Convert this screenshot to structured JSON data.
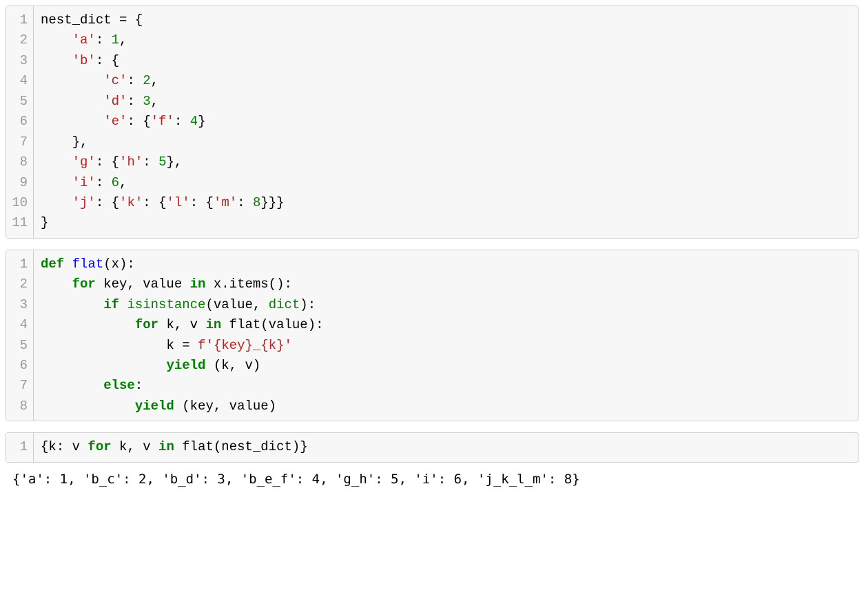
{
  "cells": [
    {
      "lines": [
        [
          {
            "t": "nest_dict "
          },
          {
            "t": "=",
            "cls": ""
          },
          {
            "t": " {"
          }
        ],
        [
          {
            "t": "    "
          },
          {
            "t": "'a'",
            "cls": "str"
          },
          {
            "t": ": "
          },
          {
            "t": "1",
            "cls": "num"
          },
          {
            "t": ","
          }
        ],
        [
          {
            "t": "    "
          },
          {
            "t": "'b'",
            "cls": "str"
          },
          {
            "t": ": {"
          }
        ],
        [
          {
            "t": "        "
          },
          {
            "t": "'c'",
            "cls": "str"
          },
          {
            "t": ": "
          },
          {
            "t": "2",
            "cls": "num"
          },
          {
            "t": ","
          }
        ],
        [
          {
            "t": "        "
          },
          {
            "t": "'d'",
            "cls": "str"
          },
          {
            "t": ": "
          },
          {
            "t": "3",
            "cls": "num"
          },
          {
            "t": ","
          }
        ],
        [
          {
            "t": "        "
          },
          {
            "t": "'e'",
            "cls": "str"
          },
          {
            "t": ": {"
          },
          {
            "t": "'f'",
            "cls": "str"
          },
          {
            "t": ": "
          },
          {
            "t": "4",
            "cls": "num"
          },
          {
            "t": "}"
          }
        ],
        [
          {
            "t": "    },"
          }
        ],
        [
          {
            "t": "    "
          },
          {
            "t": "'g'",
            "cls": "str"
          },
          {
            "t": ": {"
          },
          {
            "t": "'h'",
            "cls": "str"
          },
          {
            "t": ": "
          },
          {
            "t": "5",
            "cls": "num"
          },
          {
            "t": "},"
          }
        ],
        [
          {
            "t": "    "
          },
          {
            "t": "'i'",
            "cls": "str"
          },
          {
            "t": ": "
          },
          {
            "t": "6",
            "cls": "num"
          },
          {
            "t": ","
          }
        ],
        [
          {
            "t": "    "
          },
          {
            "t": "'j'",
            "cls": "str"
          },
          {
            "t": ": {"
          },
          {
            "t": "'k'",
            "cls": "str"
          },
          {
            "t": ": {"
          },
          {
            "t": "'l'",
            "cls": "str"
          },
          {
            "t": ": {"
          },
          {
            "t": "'m'",
            "cls": "str"
          },
          {
            "t": ": "
          },
          {
            "t": "8",
            "cls": "num"
          },
          {
            "t": "}}}"
          }
        ],
        [
          {
            "t": "}"
          }
        ]
      ]
    },
    {
      "lines": [
        [
          {
            "t": "def ",
            "cls": "kw"
          },
          {
            "t": "flat",
            "cls": "fn"
          },
          {
            "t": "(x):"
          }
        ],
        [
          {
            "t": "    "
          },
          {
            "t": "for ",
            "cls": "kw"
          },
          {
            "t": "key, value "
          },
          {
            "t": "in ",
            "cls": "kw"
          },
          {
            "t": "x"
          },
          {
            "t": "."
          },
          {
            "t": "items():"
          }
        ],
        [
          {
            "t": "        "
          },
          {
            "t": "if ",
            "cls": "kw"
          },
          {
            "t": "isinstance",
            "cls": "bi"
          },
          {
            "t": "(value, "
          },
          {
            "t": "dict",
            "cls": "bi"
          },
          {
            "t": "):"
          }
        ],
        [
          {
            "t": "            "
          },
          {
            "t": "for ",
            "cls": "kw"
          },
          {
            "t": "k, v "
          },
          {
            "t": "in ",
            "cls": "kw"
          },
          {
            "t": "flat(value):"
          }
        ],
        [
          {
            "t": "                k "
          },
          {
            "t": "="
          },
          {
            "t": " "
          },
          {
            "t": "f'",
            "cls": "sd"
          },
          {
            "t": "{key}",
            "cls": "str"
          },
          {
            "t": "_",
            "cls": "sd"
          },
          {
            "t": "{k}",
            "cls": "str"
          },
          {
            "t": "'",
            "cls": "sd"
          }
        ],
        [
          {
            "t": "                "
          },
          {
            "t": "yield ",
            "cls": "kw"
          },
          {
            "t": "(k, v)"
          }
        ],
        [
          {
            "t": "        "
          },
          {
            "t": "else",
            "cls": "kw"
          },
          {
            "t": ":"
          }
        ],
        [
          {
            "t": "            "
          },
          {
            "t": "yield ",
            "cls": "kw"
          },
          {
            "t": "(key, value)"
          }
        ]
      ]
    },
    {
      "lines": [
        [
          {
            "t": "{k: v "
          },
          {
            "t": "for ",
            "cls": "kw"
          },
          {
            "t": "k, v "
          },
          {
            "t": "in ",
            "cls": "kw"
          },
          {
            "t": "flat(nest_dict)}"
          }
        ]
      ]
    }
  ],
  "output": "{'a': 1, 'b_c': 2, 'b_d': 3, 'b_e_f': 4, 'g_h': 5, 'i': 6, 'j_k_l_m': 8}"
}
